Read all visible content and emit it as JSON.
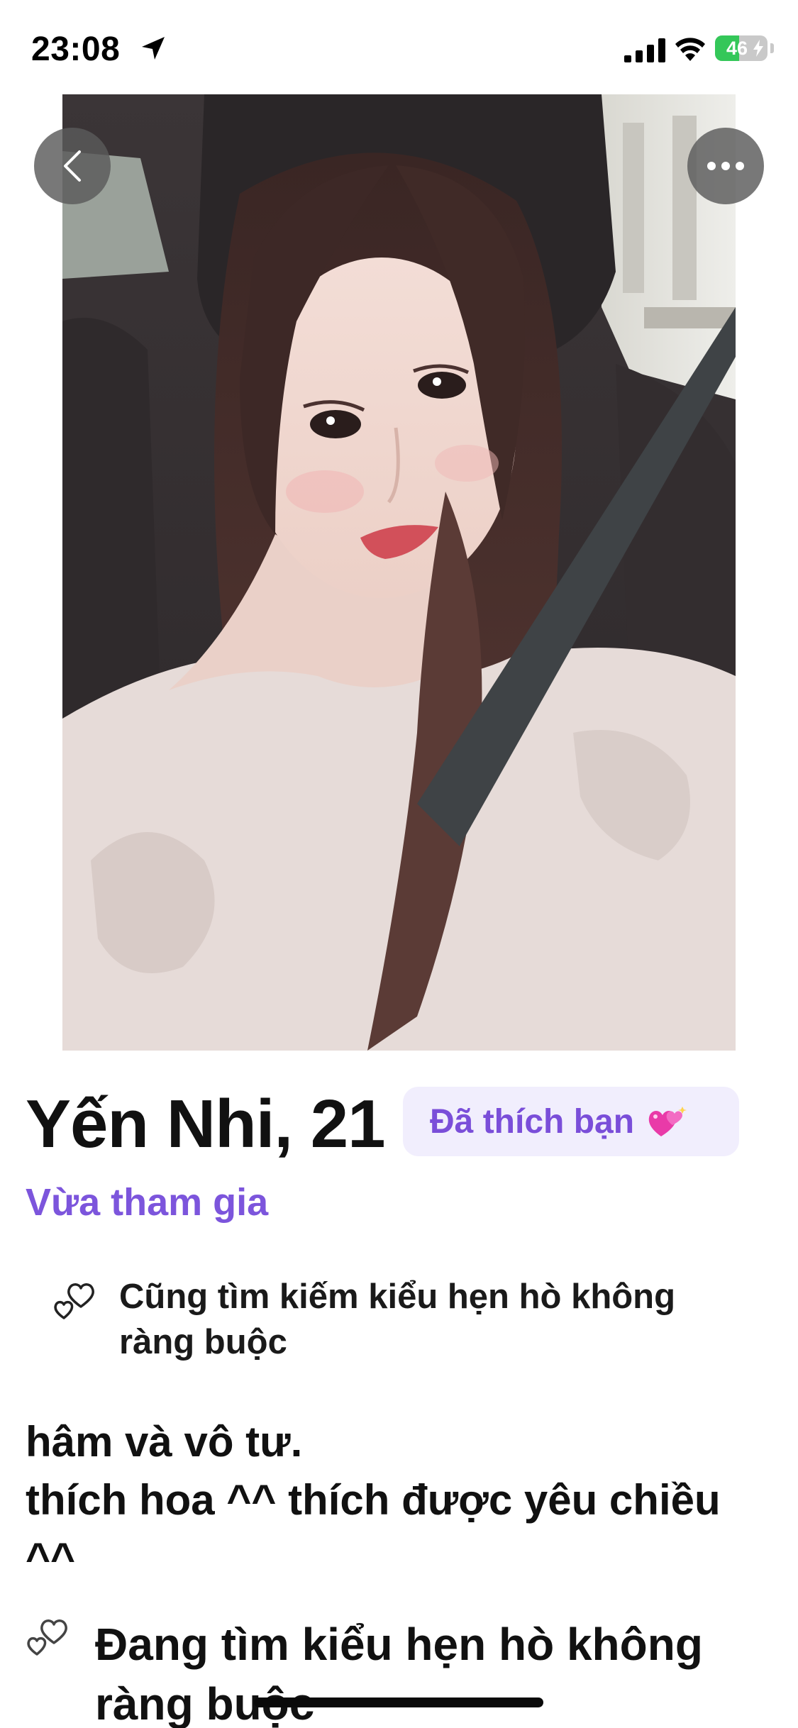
{
  "status_bar": {
    "time": "23:08",
    "battery_percent": 46,
    "battery_label": "46",
    "signal_bars": 4,
    "icons": [
      "location-arrow-icon",
      "cellular-signal-icon",
      "wifi-icon",
      "battery-charging-icon"
    ]
  },
  "photo": {
    "description_icon": "profile-photo"
  },
  "nav": {
    "back_icon": "chevron-left-icon",
    "more_icon": "more-dots-icon"
  },
  "profile": {
    "name_age": "Yến Nhi, 21",
    "liked_badge": "Đã thích bạn",
    "liked_emoji": "heart-emoji-icon",
    "status": "Vừa tham gia",
    "looking_for_short": "Cũng tìm kiếm kiểu hẹn hò không ràng buộc",
    "bio": "hâm và vô tư.\nthích hoa ^^ thích được yêu chiều ^^",
    "looking_for_heading": "Đang tìm kiểu hẹn hò không ràng buộc"
  },
  "colors": {
    "accent": "#7c55dc",
    "badge_bg": "#f1eefd",
    "battery_green": "#34c759"
  }
}
